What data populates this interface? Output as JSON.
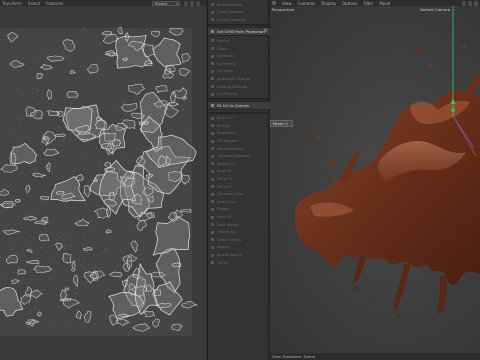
{
  "uv_editor": {
    "menu": [
      "Transform",
      "Select",
      "Features"
    ],
    "mode_select": "Project"
  },
  "tools": {
    "items": [
      {
        "label": "Select Islands",
        "type": "dim"
      },
      {
        "label": "Grow Selection",
        "type": "dim"
      },
      {
        "label": "Shrink Selection",
        "type": "dim"
      },
      {
        "label": "Set UVW from Projection",
        "type": "header",
        "gear": true
      },
      {
        "label": "Frontal",
        "type": "dim"
      },
      {
        "label": "Cubic",
        "type": "dim"
      },
      {
        "label": "Spherical",
        "type": "dim"
      },
      {
        "label": "Cylindrical",
        "type": "dim"
      },
      {
        "label": "UV Mode",
        "type": "dim"
      },
      {
        "label": "Automatic Unwrap",
        "type": "dim"
      },
      {
        "label": "Packing Settings",
        "type": "dim"
      },
      {
        "label": "UV Packing",
        "type": "dim"
      },
      {
        "label": "Fit UV to Canvas",
        "type": "header"
      },
      {
        "label": "Relax UV",
        "type": "dim"
      },
      {
        "label": "Realign",
        "type": "dim"
      },
      {
        "label": "Straighten",
        "type": "dim"
      },
      {
        "label": "UV Tangent",
        "type": "dim"
      },
      {
        "label": "Weld Selected",
        "type": "dim"
      },
      {
        "label": "Optimize Mapping",
        "type": "dim"
      },
      {
        "label": "Rotate UV",
        "type": "dim"
      },
      {
        "label": "Scale UV",
        "type": "dim"
      },
      {
        "label": "Mirror U",
        "type": "dim"
      },
      {
        "label": "Mirror V",
        "type": "dim"
      },
      {
        "label": "Transform Tool",
        "type": "dim"
      },
      {
        "label": "Island Tool",
        "type": "dim"
      },
      {
        "label": "Distort",
        "type": "dim"
      },
      {
        "label": "Lock UV",
        "type": "dim"
      },
      {
        "label": "Lock Islands",
        "type": "dim"
      },
      {
        "label": "Unlock All",
        "type": "dim"
      },
      {
        "label": "Select Seams",
        "type": "dim"
      },
      {
        "label": "Display",
        "type": "dim"
      },
      {
        "label": "Ignore Seams",
        "type": "dim"
      },
      {
        "label": "Terrain",
        "type": "dim"
      }
    ]
  },
  "viewport": {
    "menu": [
      "View",
      "Cameras",
      "Display",
      "Options",
      "Filter",
      "Panel"
    ],
    "perspective_label": "Perspective",
    "camera_label": "Default Camera",
    "hud_label": "Mixer",
    "status": "View Transform: Scene"
  },
  "colors": {
    "uv_background": "#3b3b3b",
    "uv_lines": "#e6e6e6",
    "viewport_background": "#3a3a3a",
    "chocolate": "#6e3520",
    "axis_green": "#34c759",
    "axis_red": "#d33a2c",
    "axis_blue": "#3a6bd3"
  }
}
